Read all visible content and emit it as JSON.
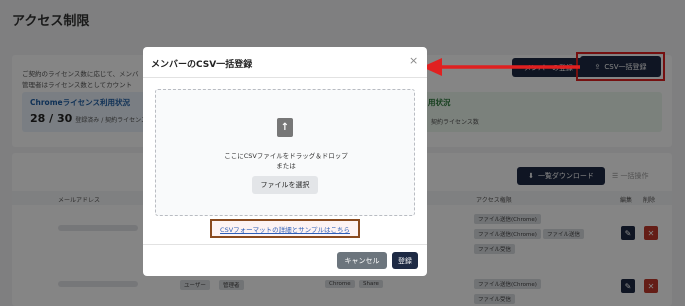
{
  "page": {
    "title": "アクセス制限"
  },
  "summary": {
    "desc_line1": "ご契約のライセンス数に応じて、メンバ",
    "desc_line2": "管理者はライセンス数としてカウント",
    "add_member_label": "メンバーの登録",
    "csv_button_label": "CSV一括登録",
    "chrome_title": "Chromeライセンス利用状況",
    "chrome_value": "28 / 30",
    "chrome_note": "登録済み / 契約ライセンス",
    "second_title": "用状況",
    "second_note": "契約ライセンス数"
  },
  "table": {
    "download_label": "一覧ダウンロード",
    "bulk_label": "一括操作",
    "headers": {
      "email": "メールアドレス",
      "access": "アクセス権限",
      "edit": "編集",
      "delete": "削除"
    },
    "tags": [
      "ファイル送信(Chrome)",
      "ファイル送信(Chrome)",
      "ファイル送信",
      "ファイル受信",
      "ユーザー",
      "管理者",
      "Chrome",
      "Share",
      "ファイル送信(Chrome)",
      "ファイル受信"
    ]
  },
  "modal": {
    "title": "メンバーのCSV一括登録",
    "close_symbol": "×",
    "drop_text": "ここにCSVファイルをドラッグ＆ドロップ",
    "or_text": "または",
    "select_label": "ファイルを選択",
    "format_link": "CSVフォーマットの詳細とサンプルはこちら",
    "cancel_label": "キャンセル",
    "submit_label": "登録"
  },
  "colors": {
    "navy": "#1e2a44",
    "highlight_red": "#e02020",
    "link_blue": "#2f5fb8"
  }
}
